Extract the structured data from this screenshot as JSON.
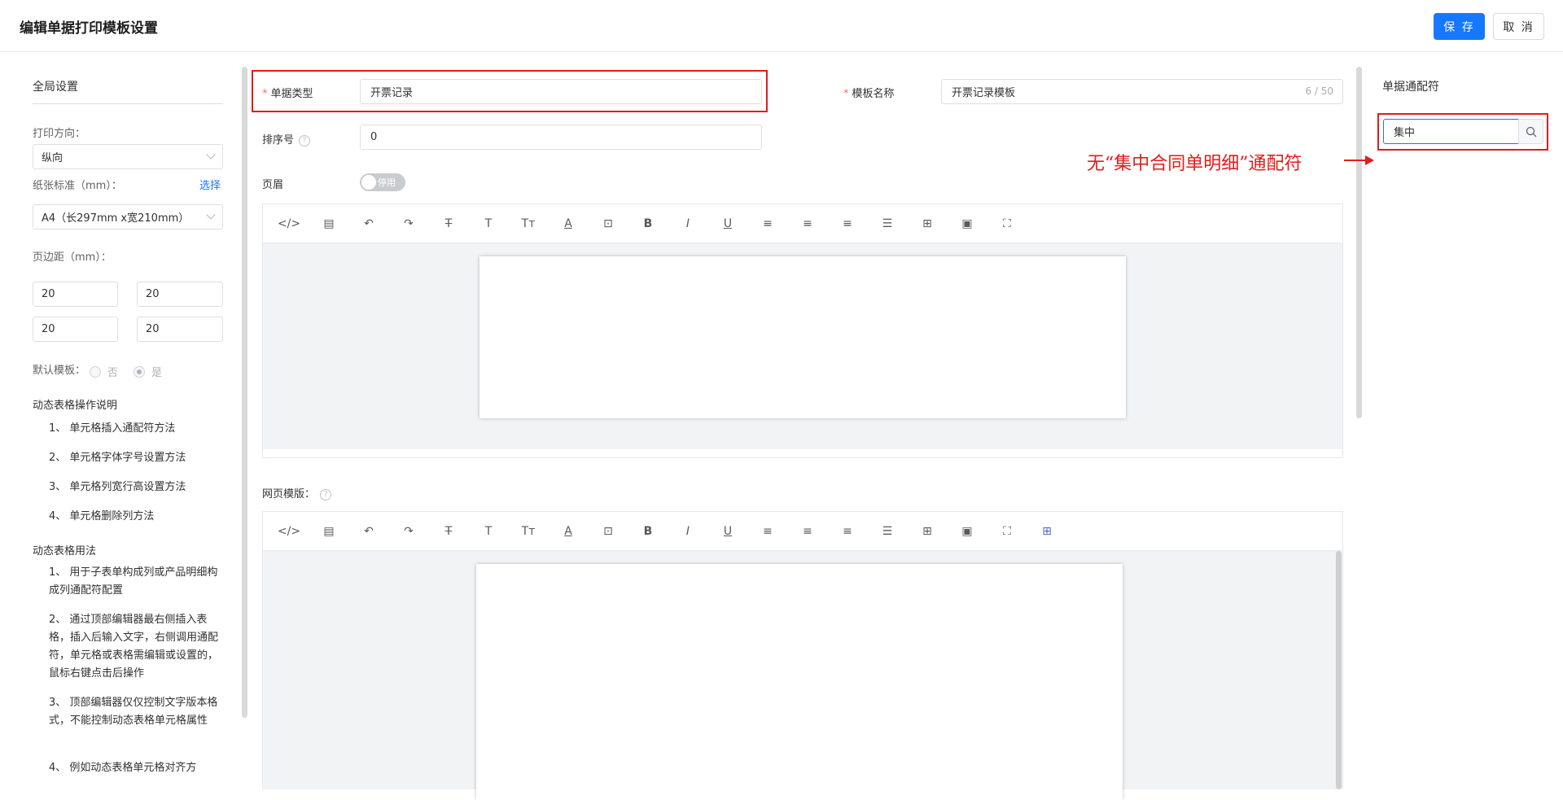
{
  "header": {
    "title": "编辑单据打印模板设置",
    "save_label": "保 存",
    "cancel_label": "取 消"
  },
  "left": {
    "section_title": "全局设置",
    "print_direction_label": "打印方向：",
    "print_direction_value": "纵向",
    "paper_std_label": "纸张标准（mm）：",
    "paper_select_link": "选择",
    "paper_value": "A4（长297mm x宽210mm）",
    "margin_label": "页边距（mm）：",
    "margins": [
      "20",
      "20",
      "20",
      "20"
    ],
    "default_label": "默认模板：",
    "default_no": "否",
    "default_yes": "是",
    "help1_title": "动态表格操作说明",
    "help1_items": [
      "1、 单元格插入通配符方法",
      "2、 单元格字体字号设置方法",
      "3、 单元格列宽行高设置方法",
      "4、 单元格删除列方法"
    ],
    "help2_title": "动态表格用法",
    "help2_items": [
      "1、 用于子表单构成列或产品明细构成列通配符配置",
      "2、 通过顶部编辑器最右侧插入表格，插入后输入文字，右侧调用通配符，单元格或表格需编辑或设置的，鼠标右键点击后操作",
      "3、 顶部编辑器仅仅控制文字版本格式，不能控制动态表格单元格属性",
      "4、 例如动态表格单元格对齐方"
    ]
  },
  "form": {
    "doc_type_label": "单据类型",
    "doc_type_value": "开票记录",
    "tpl_name_label": "模板名称",
    "tpl_name_value": "开票记录模板",
    "tpl_name_counter": "6 / 50",
    "sort_label": "排序号",
    "sort_value": "0",
    "header_label": "页眉",
    "header_switch": "停用",
    "web_tpl_label": "网页模版："
  },
  "right": {
    "title": "单据通配符",
    "search_value": "集中"
  },
  "annotation": "无“集中合同单明细”通配符",
  "colors": {
    "primary": "#1677ff",
    "annotation_red": "#e31b1b"
  }
}
